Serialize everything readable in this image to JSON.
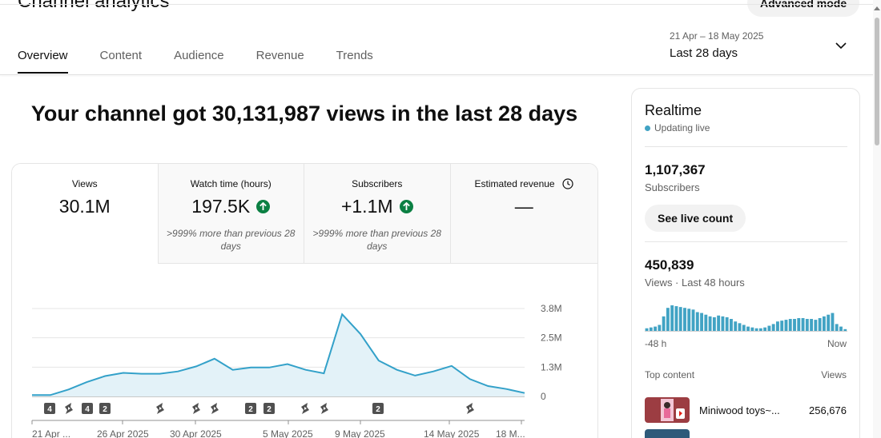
{
  "header": {
    "title": "Channel analytics",
    "advanced_mode_label": "Advanced mode",
    "tabs": [
      {
        "label": "Overview",
        "active": true
      },
      {
        "label": "Content",
        "active": false
      },
      {
        "label": "Audience",
        "active": false
      },
      {
        "label": "Revenue",
        "active": false
      },
      {
        "label": "Trends",
        "active": false
      }
    ],
    "date_range": {
      "dates": "21 Apr – 18 May 2025",
      "label": "Last 28 days",
      "icon": "chevron-down-icon"
    }
  },
  "headline": "Your channel got 30,131,987 views in the last 28 days",
  "metrics": [
    {
      "label": "Views",
      "value": "30.1M",
      "note": ""
    },
    {
      "label": "Watch time (hours)",
      "value": "197.5K",
      "note": ">999% more than previous 28 days",
      "trend": "up"
    },
    {
      "label": "Subscribers",
      "value": "+1.1M",
      "note": ">999% more than previous 28 days",
      "trend": "up"
    },
    {
      "label": "Estimated revenue",
      "value": "—",
      "note": "",
      "icon": "clock-icon"
    }
  ],
  "chart_data": {
    "type": "area",
    "y_ticks": [
      "3.8M",
      "2.5M",
      "1.3M",
      "0"
    ],
    "ylim": [
      0,
      3800000
    ],
    "x_tick_labels": [
      "21 Apr ...",
      "26 Apr 2025",
      "30 Apr 2025",
      "5 May 2025",
      "9 May 2025",
      "14 May 2025",
      "18 M..."
    ],
    "series": [
      {
        "values": [
          60000,
          60000,
          300000,
          620000,
          880000,
          1020000,
          980000,
          980000,
          1080000,
          1300000,
          1630000,
          1150000,
          1250000,
          1250000,
          1400000,
          1150000,
          1000000,
          3550000,
          2700000,
          1550000,
          1150000,
          900000,
          1080000,
          1320000,
          750000,
          450000,
          320000,
          150000
        ]
      }
    ],
    "color": "#33a1c9",
    "fill": "#e3f2f8",
    "markers": [
      {
        "type": "badge",
        "text": "4"
      },
      {
        "type": "shorts"
      },
      {
        "type": "badge",
        "text": "4"
      },
      {
        "type": "badge",
        "text": "2"
      },
      {
        "type": "shorts"
      },
      {
        "type": "shorts"
      },
      {
        "type": "shorts"
      },
      {
        "type": "badge",
        "text": "2"
      },
      {
        "type": "badge",
        "text": "2"
      },
      {
        "type": "shorts"
      },
      {
        "type": "shorts"
      },
      {
        "type": "badge",
        "text": "2"
      },
      {
        "type": "shorts"
      }
    ]
  },
  "realtime": {
    "title": "Realtime",
    "status": "Updating live",
    "subscribers_value": "1,107,367",
    "subscribers_label": "Subscribers",
    "see_live_label": "See live count",
    "views_value": "450,839",
    "views_label": "Views · Last 48 hours",
    "bars": [
      4,
      5,
      6,
      8,
      18,
      28,
      31,
      30,
      29,
      28,
      27,
      26,
      23,
      22,
      20,
      18,
      17,
      19,
      18,
      17,
      15,
      12,
      10,
      8,
      6,
      5,
      4,
      4,
      5,
      7,
      9,
      12,
      13,
      14,
      15,
      15,
      16,
      16,
      15,
      15,
      14,
      16,
      18,
      20,
      22,
      9,
      6,
      3
    ],
    "bar_start_label": "-48 h",
    "bar_end_label": "Now",
    "top_content_label": "Top content",
    "top_content_views_label": "Views",
    "top_items": [
      {
        "title": "Miniwood toys~...",
        "views": "256,676",
        "thumb_color": "#b04a4a"
      }
    ],
    "accent": "#41a3c4"
  }
}
